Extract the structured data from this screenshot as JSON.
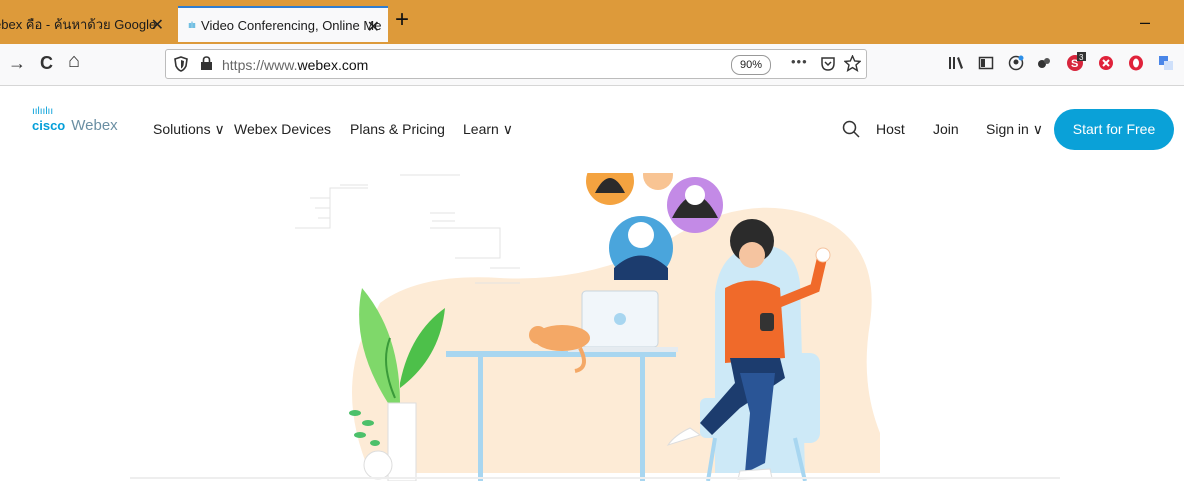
{
  "tabs": [
    {
      "title": "ebex คือ - ค้นหาด้วย Google",
      "close": "✕"
    },
    {
      "title": "Video Conferencing, Online Me",
      "close": "✕",
      "favicon": "cisco-favicon"
    }
  ],
  "new_tab": "+",
  "window_minimize": "–",
  "toolbar": {
    "back": "→",
    "reload": "C",
    "home": "⌂",
    "url": "https://www.webex.com",
    "url_prefix": "https://www.",
    "url_domain": "webex.com",
    "zoom": "90%",
    "more": "•••"
  },
  "site": {
    "brand": "cisco",
    "product": "Webex",
    "nav": {
      "solutions": "Solutions ∨",
      "devices": "Webex Devices",
      "pricing": "Plans & Pricing",
      "learn": "Learn ∨",
      "host": "Host",
      "join": "Join",
      "signin": "Sign in ∨",
      "start": "Start for Free"
    }
  },
  "colors": {
    "tabbar": "#dd9a3a",
    "accent": "#0aa1d8",
    "blob": "#fdebd6"
  }
}
